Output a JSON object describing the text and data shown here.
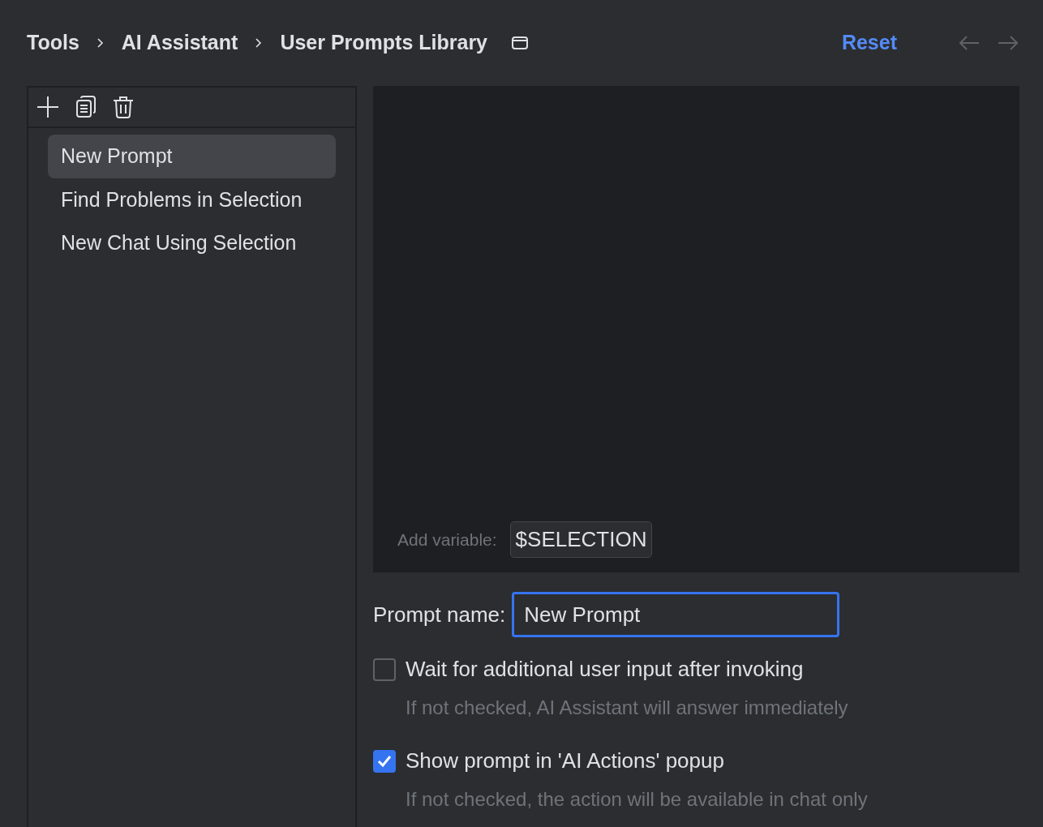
{
  "breadcrumbs": [
    "Tools",
    "AI Assistant",
    "User Prompts Library"
  ],
  "reset": "Reset",
  "prompts": [
    {
      "label": "New Prompt",
      "selected": true
    },
    {
      "label": "Find Problems in Selection",
      "selected": false
    },
    {
      "label": "New Chat Using Selection",
      "selected": false
    }
  ],
  "editor": {
    "add_variable_label": "Add variable:",
    "variables": [
      "$SELECTION"
    ]
  },
  "prompt_name": {
    "label": "Prompt name:",
    "value": "New Prompt"
  },
  "options": [
    {
      "label": "Wait for additional user input after invoking",
      "hint": "If not checked, AI Assistant will answer immediately",
      "checked": false
    },
    {
      "label": "Show prompt in 'AI Actions' popup",
      "hint": "If not checked, the action will be available in chat only",
      "checked": true
    }
  ]
}
